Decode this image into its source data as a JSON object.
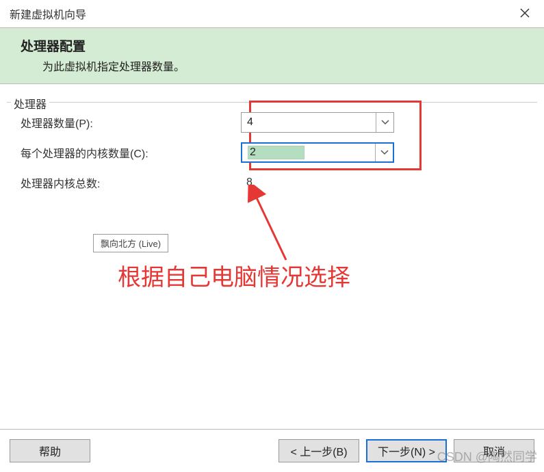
{
  "titlebar": {
    "title": "新建虚拟机向导"
  },
  "header": {
    "heading": "处理器配置",
    "subheading": "为此虚拟机指定处理器数量。"
  },
  "group": {
    "legend": "处理器"
  },
  "fields": {
    "processor_count": {
      "label": "处理器数量(P):",
      "value": "4"
    },
    "cores_per_processor": {
      "label": "每个处理器的内核数量(C):",
      "value": "2"
    },
    "total_cores": {
      "label": "处理器内核总数:",
      "value": "8"
    }
  },
  "tooltip": {
    "text": "飘向北方 (Live)"
  },
  "annotation": {
    "text": "根据自己电脑情况选择"
  },
  "footer": {
    "help": "帮助",
    "prev": "< 上一步(B)",
    "next": "下一步(N) >",
    "cancel": "取消"
  },
  "watermark": "CSDN @陶然同学"
}
